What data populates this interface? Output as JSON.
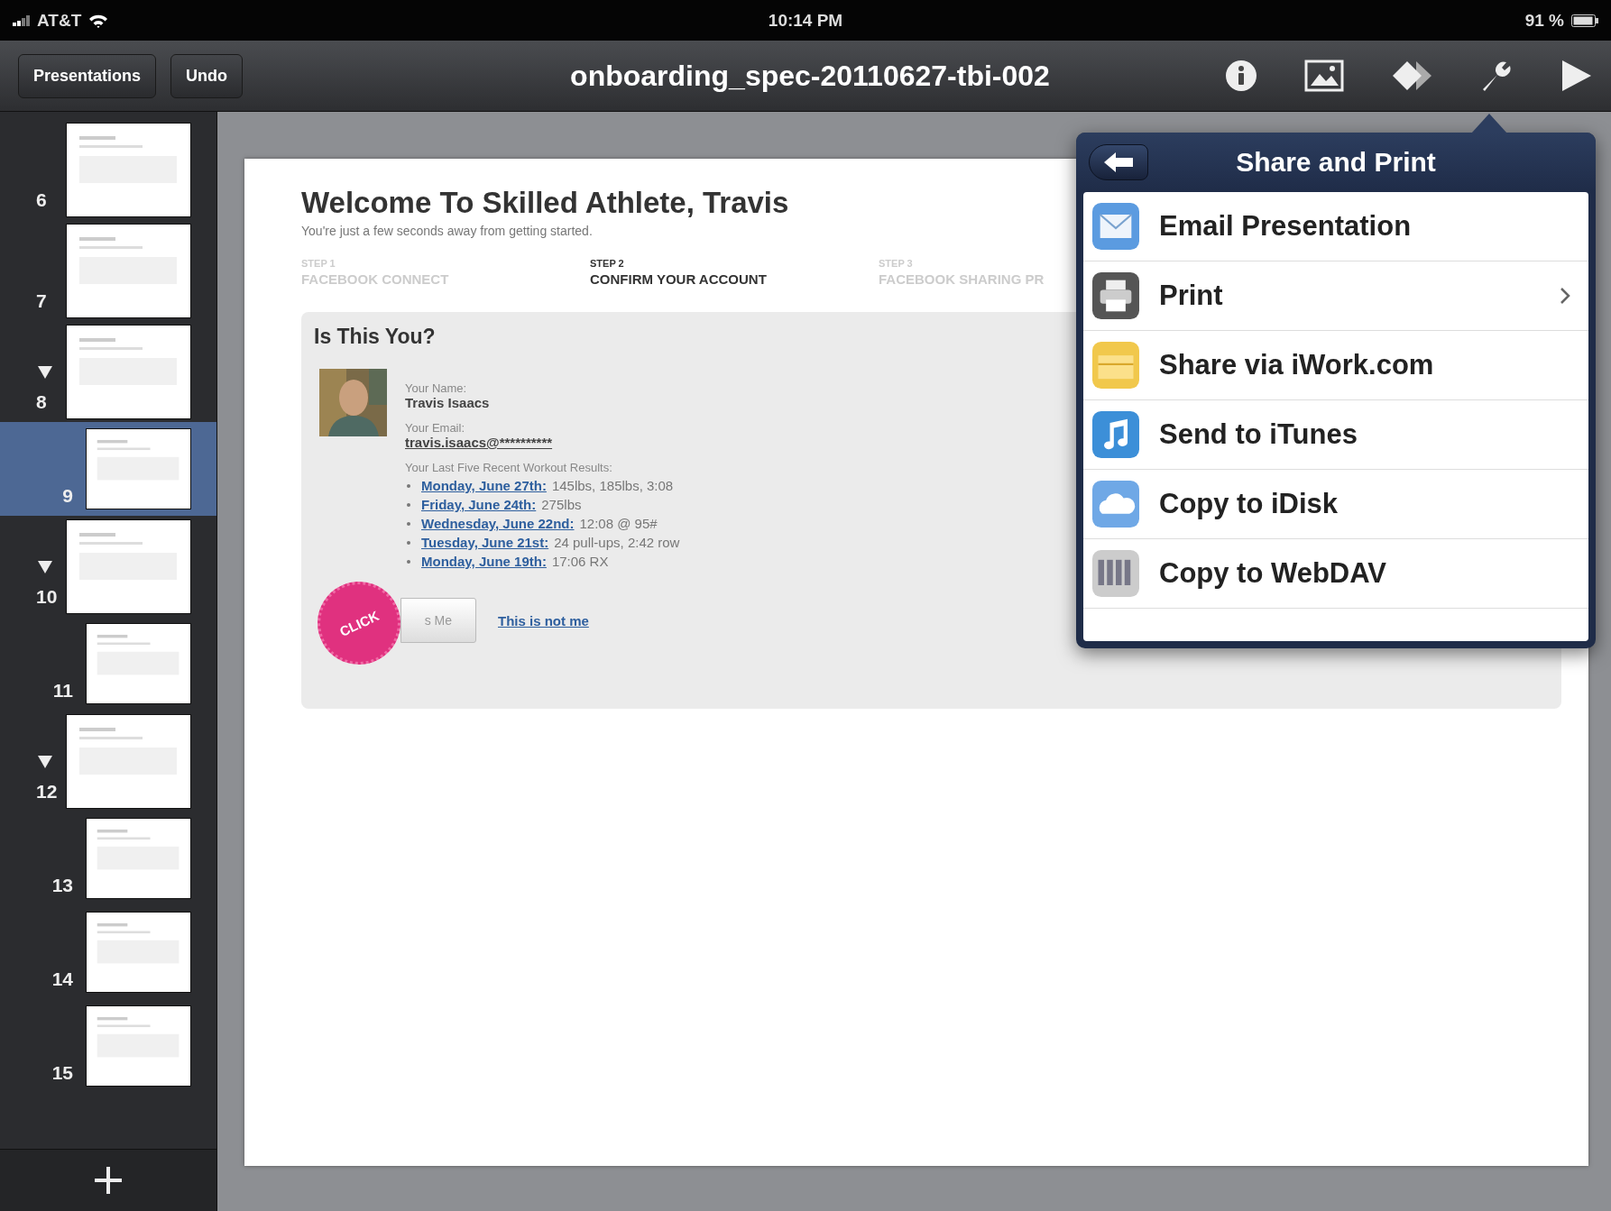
{
  "status_bar": {
    "carrier": "AT&T",
    "time": "10:14 PM",
    "battery": "91 %"
  },
  "toolbar": {
    "buttons": [
      "Presentations",
      "Undo"
    ],
    "title": "onboarding_spec-20110627-tbi-002",
    "tools": [
      {
        "kind": "info"
      },
      {
        "kind": "media"
      },
      {
        "kind": "shapes"
      },
      {
        "kind": "tools"
      },
      {
        "kind": "play"
      }
    ]
  },
  "slides": [
    {
      "number": "6",
      "selected": false
    },
    {
      "number": "7",
      "selected": false
    },
    {
      "number": "8",
      "selected": false,
      "expanded": true,
      "children": [
        {
          "number": "9",
          "selected": true
        }
      ]
    },
    {
      "number": "10",
      "selected": false,
      "expanded": true,
      "children": [
        {
          "number": "11",
          "selected": false
        }
      ]
    },
    {
      "number": "12",
      "selected": false,
      "expanded": true,
      "children": [
        {
          "number": "13",
          "selected": false
        },
        {
          "number": "14",
          "selected": false
        },
        {
          "number": "15",
          "selected": false
        }
      ]
    }
  ],
  "slide": {
    "title": "Welcome To Skilled Athlete, Travis",
    "subtitle": "You're just a few seconds away from getting started.",
    "steps": [
      {
        "step": "STEP 1",
        "name": "FACEBOOK CONNECT",
        "current": false
      },
      {
        "step": "STEP 2",
        "name": "CONFIRM YOUR ACCOUNT",
        "current": true
      },
      {
        "step": "STEP 3",
        "name": "FACEBOOK SHARING PR",
        "current": false
      }
    ],
    "card": {
      "heading": "Is This You?",
      "name_label": "Your Name:",
      "name": "Travis Isaacs",
      "email_label": "Your Email:",
      "email": "travis.isaacs@**********",
      "workouts_label": "Your Last Five Recent Workout Results:",
      "workouts": [
        {
          "date": "Monday, June 27th:",
          "result": "145lbs, 185lbs, 3:08"
        },
        {
          "date": "Friday, June 24th:",
          "result": "275lbs"
        },
        {
          "date": "Wednesday, June 22nd:",
          "result": "12:08 @ 95#"
        },
        {
          "date": "Tuesday, June 21st:",
          "result": "24 pull-ups, 2:42 row"
        },
        {
          "date": "Monday, June 19th:",
          "result": "17:06 RX"
        }
      ],
      "confirm_button": "s Me",
      "not_me_link": "This is not me",
      "sticker": "CLICK"
    }
  },
  "popover": {
    "title": "Share and Print",
    "items": [
      {
        "kind": "email",
        "label": "Email Presentation",
        "has_submenu": false
      },
      {
        "kind": "print",
        "label": "Print",
        "has_submenu": true
      },
      {
        "kind": "iwork",
        "label": "Share via iWork.com",
        "has_submenu": false
      },
      {
        "kind": "itunes",
        "label": "Send to iTunes",
        "has_submenu": false
      },
      {
        "kind": "idisk",
        "label": "Copy to iDisk",
        "has_submenu": false
      },
      {
        "kind": "webdav",
        "label": "Copy to WebDAV",
        "has_submenu": false
      }
    ]
  }
}
